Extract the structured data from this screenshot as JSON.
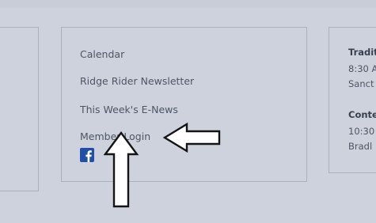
{
  "links": {
    "calendar": "Calendar",
    "newsletter": "Ridge Rider Newsletter",
    "enews": "This Week's E-News",
    "member_login": "Member Login"
  },
  "social": {
    "facebook_icon": "facebook-icon",
    "facebook_color": "#1f4fa6"
  },
  "annotations": {
    "arrow_left_icon": "arrow-left-outline-icon",
    "arrow_up_icon": "arrow-up-outline-icon"
  },
  "right_panel": {
    "service1_title": "Tradit",
    "service1_time": "8:30 A",
    "service1_place": "Sanct",
    "service2_title": "Conte",
    "service2_time": "10:30",
    "service2_place": "Bradl"
  },
  "colors": {
    "background": "#ced2dc",
    "border": "#aab0bd",
    "text": "#4d5566"
  }
}
